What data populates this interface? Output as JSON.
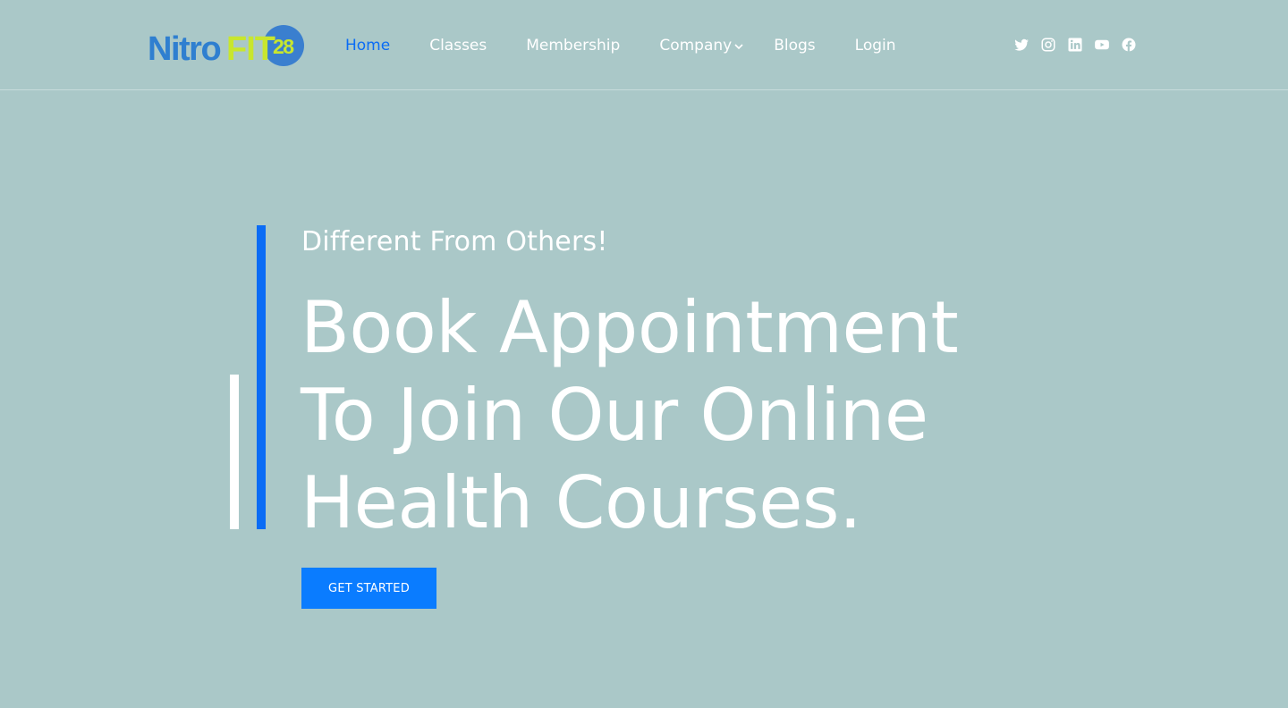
{
  "brand": {
    "part1": "Nitro",
    "part2": "FIT",
    "part3": "28",
    "colors": {
      "blue": "#2f7fd0",
      "lime": "#c8e62e",
      "circle": "#3a7fcf"
    }
  },
  "nav": {
    "items": [
      {
        "label": "Home",
        "active": true
      },
      {
        "label": "Classes"
      },
      {
        "label": "Membership"
      },
      {
        "label": "Company",
        "dropdown": true
      },
      {
        "label": "Blogs"
      },
      {
        "label": "Login"
      }
    ]
  },
  "social": [
    "twitter-icon",
    "instagram-icon",
    "linkedin-icon",
    "youtube-icon",
    "facebook-icon"
  ],
  "hero": {
    "subtitle": "Different From Others!",
    "headline": [
      "Book Appointment",
      "To Join Our Online",
      "Health Courses."
    ],
    "cta": "GET STARTED"
  },
  "colors": {
    "background": "#aac8c8",
    "accent": "#0a6cf5",
    "button": "#0a7cff",
    "text": "#ffffff"
  }
}
